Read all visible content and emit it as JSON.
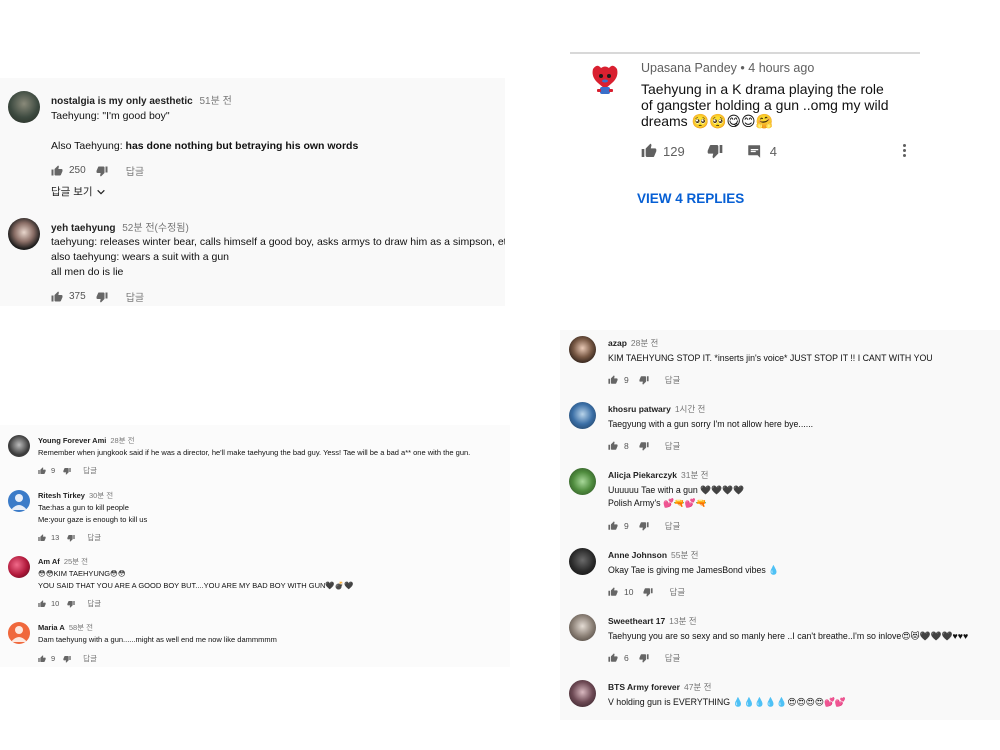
{
  "panel_top_left": {
    "comments": [
      {
        "author": "nostalgia is my only aesthetic",
        "time": "51분 전",
        "line1": "Taehyung: \"I'm good boy\"",
        "line2_prefix": "Also Taehyung: ",
        "line2_bold": "has done nothing but betraying his own words",
        "likes": "250",
        "reply": "답글",
        "view_replies": "답글 보기"
      },
      {
        "author": "yeh taehyung",
        "time": "52분 전(수정됨)",
        "line1": "taehyung: releases winter bear, calls himself a good boy, asks armys to draw him as a simpson, et",
        "line2": "also taehyung: wears a suit with a gun",
        "line3": "all men do is lie",
        "likes": "375",
        "reply": "답글"
      }
    ]
  },
  "panel_top_right": {
    "author": "Upasana Pandey",
    "time": "4 hours ago",
    "text_lines": [
      "Taehyung in a K drama playing the role",
      "of gangster holding a gun ..omg my wild",
      "dreams 🥺🥺😋😊🤗"
    ],
    "likes": "129",
    "replies_count": "4",
    "view_replies": "VIEW 4 REPLIES",
    "accent": "#065fd4"
  },
  "panel_bottom_left": {
    "comments": [
      {
        "author": "Young Forever Ami",
        "time": "28분 전",
        "text": [
          "Remember when jungkook said if he was a director, he'll make taehyung the bad guy. Yess! Tae will be a bad a** one with the gun."
        ],
        "likes": "9",
        "reply": "답글"
      },
      {
        "author": "Ritesh Tirkey",
        "time": "30분 전",
        "text": [
          "Tae:has a gun to kill people",
          "Me:your gaze is enough to kill us"
        ],
        "likes": "13",
        "reply": "답글"
      },
      {
        "author": "Am Af",
        "time": "25분 전",
        "text": [
          "😳😳KIM TAEHYUNG😳😳",
          "YOU SAID THAT YOU ARE A GOOD BOY BUT....YOU ARE MY BAD BOY WITH GUN🖤💣🖤"
        ],
        "likes": "10",
        "reply": "답글"
      },
      {
        "author": "Maria A",
        "time": "58분 전",
        "text": [
          "Dam taehyung with a gun......might as well end me now like dammmmm"
        ],
        "likes": "9",
        "reply": "답글"
      }
    ]
  },
  "panel_bottom_right": {
    "comments": [
      {
        "author": "azap",
        "time": "28분 전",
        "text": [
          "KIM TAEHYUNG STOP IT. *inserts jin's voice* JUST STOP IT !! I CANT WITH YOU"
        ],
        "likes": "9",
        "reply": "답글"
      },
      {
        "author": "khosru patwary",
        "time": "1시간 전",
        "text": [
          "Taegyung with a gun sorry I'm not allow here bye......"
        ],
        "likes": "8",
        "reply": "답글"
      },
      {
        "author": "Alicja Piekarczyk",
        "time": "31분 전",
        "text": [
          "Uuuuuu Tae with a gun 🖤🖤🖤🖤",
          "Polish Army's 💕🔫💕🔫"
        ],
        "likes": "9",
        "reply": "답글"
      },
      {
        "author": "Anne Johnson",
        "time": "55분 전",
        "text": [
          "Okay Tae is giving me JamesBond vibes 💧"
        ],
        "likes": "10",
        "reply": "답글"
      },
      {
        "author": "Sweetheart 17",
        "time": "13분 전",
        "text": [
          "Taehyung you are so sexy and so manly here ..I can't breathe..I'm so inlove😍😻🖤🖤🖤♥♥♥"
        ],
        "likes": "6",
        "reply": "답글"
      },
      {
        "author": "BTS Army forever",
        "time": "47분 전",
        "text": [
          "V holding gun is EVERYTHING 💧💧💧💧💧😍😍😍😍💕💕"
        ]
      }
    ]
  }
}
